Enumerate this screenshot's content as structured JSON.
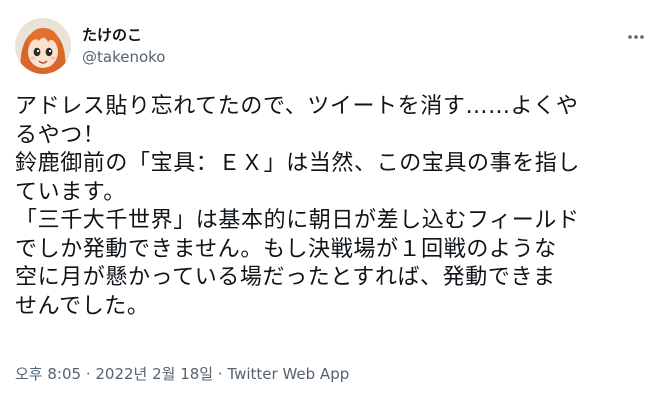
{
  "user": {
    "display_name": "たけのこ",
    "handle": "@takenoko",
    "avatar_icon": "anime-avatar-icon"
  },
  "tweet": {
    "lines": [
      "アドレス貼り忘れてたので、ツイートを消す……よくや",
      "るやつ！",
      "鈴鹿御前の「宝具：ＥＸ」は当然、この宝具の事を指し",
      "ています。",
      "「三千大千世界」は基本的に朝日が差し込むフィールド",
      "でしか発動できません。もし決戦場が１回戦のような",
      "空に月が懸かっている場だったとすれば、発動できま",
      "せんでした。"
    ]
  },
  "meta": {
    "timestamp": "오후 8:05 · 2022년 2월 18일",
    "separator": " · ",
    "source": "Twitter Web App"
  },
  "colors": {
    "text": "#0f1419",
    "secondary": "#536471"
  },
  "icons": {
    "more": "more-dots-icon"
  }
}
